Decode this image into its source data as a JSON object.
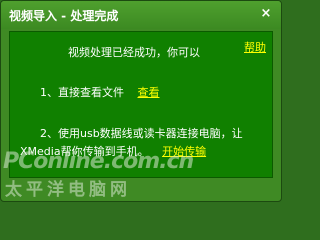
{
  "window": {
    "title": "视频导入 - 处理完成",
    "close_glyph": "×"
  },
  "content": {
    "headline": "视频处理已经成功，你可以",
    "help_link": "帮助",
    "step1": {
      "text": "1、直接查看文件",
      "link": "查看"
    },
    "step2": {
      "line1": "2、使用usb数据线或读卡器连接电脑，让",
      "line2": "XMedia帮你传输到手机。",
      "link": "开始传输"
    }
  },
  "watermark": {
    "top": "PConline.com.cn",
    "bottom": "太平洋电脑网"
  },
  "colors": {
    "window_bg": "#3f8a24",
    "content_bg": "#108000",
    "link": "#ffff00",
    "text": "#ffffff"
  }
}
